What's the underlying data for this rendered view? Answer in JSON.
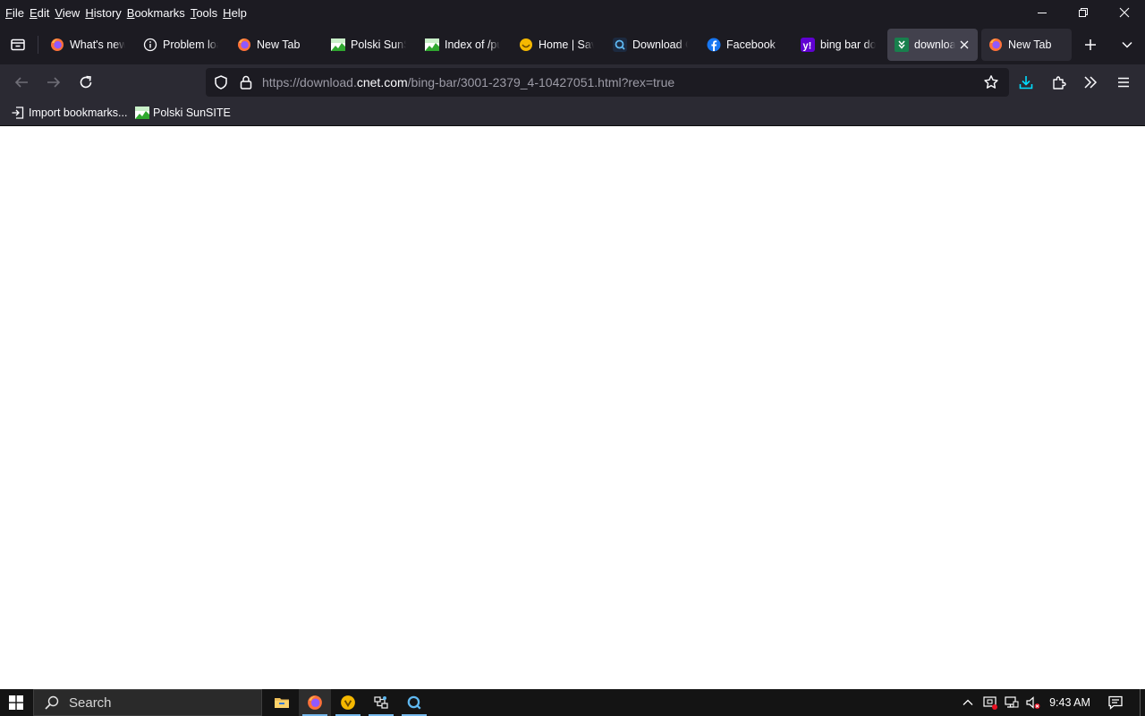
{
  "menubar": {
    "items": [
      {
        "accel": "F",
        "rest": "ile"
      },
      {
        "accel": "E",
        "rest": "dit"
      },
      {
        "accel": "V",
        "rest": "iew"
      },
      {
        "accel": "H",
        "rest": "istory"
      },
      {
        "accel": "B",
        "rest": "ookmarks"
      },
      {
        "accel": "T",
        "rest": "ools"
      },
      {
        "accel": "H",
        "rest": "elp"
      }
    ]
  },
  "tabs": [
    {
      "label": "What's new",
      "icon": "firefox-icon"
    },
    {
      "label": "Problem loading page",
      "icon": "info-icon"
    },
    {
      "label": "New Tab",
      "icon": "firefox-icon"
    },
    {
      "label": "Polski SunSITE",
      "icon": "sunsite-icon"
    },
    {
      "label": "Index of /pub",
      "icon": "sunsite-icon"
    },
    {
      "label": "Home | Savvy",
      "icon": "savvy-icon"
    },
    {
      "label": "Download Qualys",
      "icon": "qualys-icon"
    },
    {
      "label": "Facebook",
      "icon": "facebook-icon"
    },
    {
      "label": "bing bar download",
      "icon": "yahoo-icon"
    },
    {
      "label": "download",
      "icon": "cnet-icon",
      "selected": true
    },
    {
      "label": "New Tab",
      "icon": "firefox-icon"
    }
  ],
  "urlbar": {
    "prefix": "https://download.",
    "host": "cnet.com",
    "path": "/bing-bar/3001-2379_4-10427051.html?rex=true"
  },
  "bookmarks": {
    "items": [
      {
        "label": "Import bookmarks...",
        "icon": "import-icon"
      },
      {
        "label": "Polski SunSITE",
        "icon": "sunsite-icon"
      }
    ]
  },
  "taskbar": {
    "search_label": "Search",
    "clock": "9:43 AM"
  },
  "colors": {
    "chrome_dark": "#1c1b22",
    "toolbar": "#2b2a33",
    "selected_tab": "#42414d",
    "download_accent": "#00ddff",
    "taskbar": "#141414"
  }
}
